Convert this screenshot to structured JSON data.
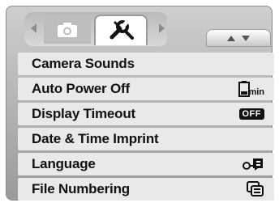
{
  "menu": {
    "items": [
      {
        "label": "Camera Sounds",
        "value_icon": ""
      },
      {
        "label": "Auto Power Off",
        "value_icon": "battery-min-icon",
        "value_text": "min"
      },
      {
        "label": "Display Timeout",
        "value_icon": "off-badge",
        "value_text": "OFF"
      },
      {
        "label": "Date & Time Imprint",
        "value_icon": ""
      },
      {
        "label": "Language",
        "value_icon": "language-icon"
      },
      {
        "label": "File Numbering",
        "value_icon": "file-numbering-icon"
      }
    ]
  },
  "tabs": {
    "camera_icon": "camera-icon",
    "setup_icon": "wrench-icon",
    "active": "setup"
  },
  "scroll_indicator": {
    "up_icon": "triangle-up-icon",
    "down_icon": "triangle-down-icon"
  },
  "colors": {
    "row_bg": "#e9e9e9",
    "frame_bg": "#b0b0b0",
    "text": "#111111"
  }
}
